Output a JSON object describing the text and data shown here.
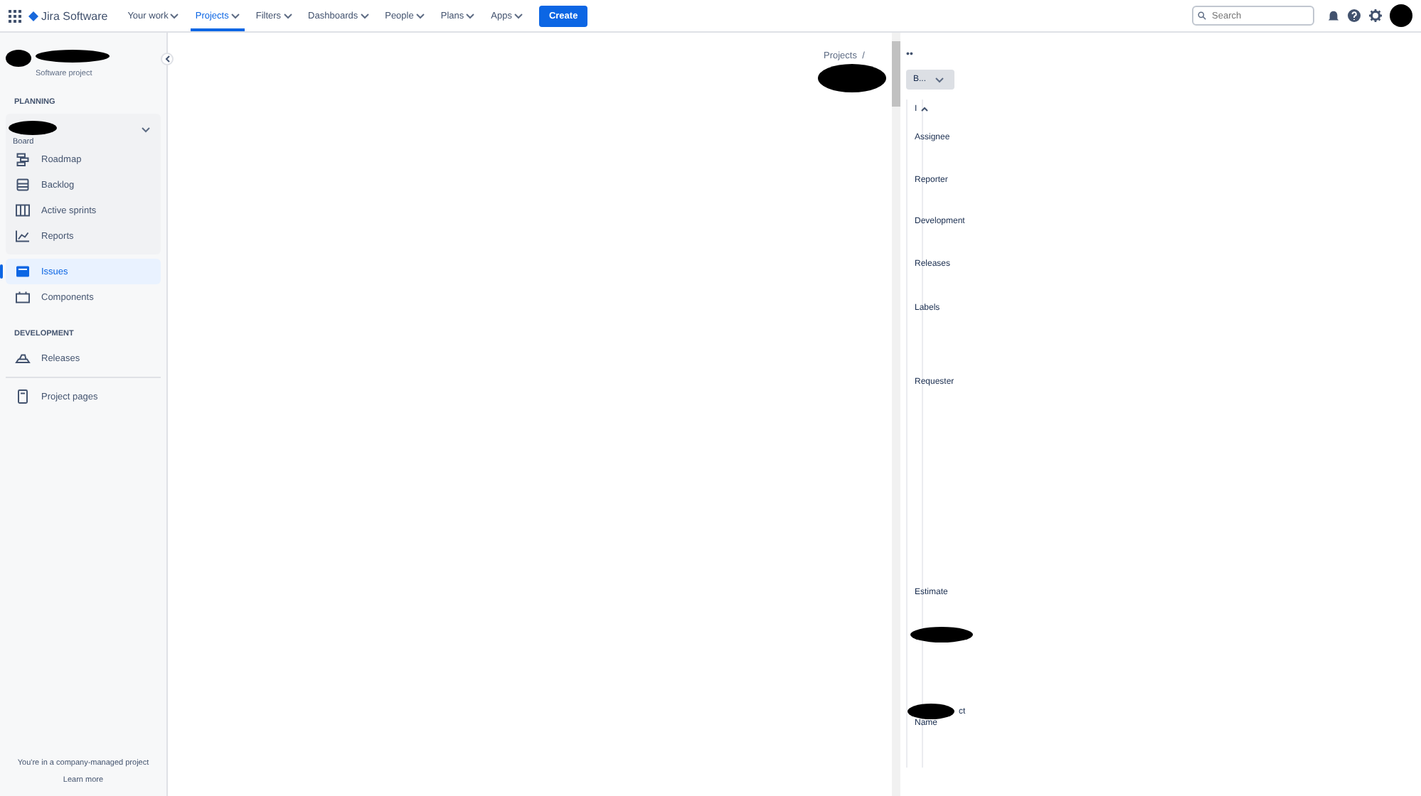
{
  "topbar": {
    "product": "Jira Software",
    "nav": [
      {
        "label": "Your work",
        "selected": false
      },
      {
        "label": "Projects",
        "selected": true
      },
      {
        "label": "Filters",
        "selected": false
      },
      {
        "label": "Dashboards",
        "selected": false
      },
      {
        "label": "People",
        "selected": false
      },
      {
        "label": "Plans",
        "selected": false
      },
      {
        "label": "Apps",
        "selected": false
      }
    ],
    "create": "Create",
    "search": {
      "placeholder": "Search"
    }
  },
  "sidebar": {
    "project_type": "Software project",
    "sections": [
      {
        "title": "PLANNING",
        "board": {
          "label": "Board",
          "expanded": true,
          "items": [
            {
              "label": "Roadmap",
              "kind": "roadmap",
              "selected": false
            },
            {
              "label": "Backlog",
              "kind": "backlog",
              "selected": false
            },
            {
              "label": "Active sprints",
              "kind": "sprints",
              "selected": false
            },
            {
              "label": "Reports",
              "kind": "reports",
              "selected": false
            }
          ]
        },
        "items": [
          {
            "label": "Issues",
            "kind": "issues",
            "selected": true
          },
          {
            "label": "Components",
            "kind": "components",
            "selected": false
          }
        ]
      },
      {
        "title": "DEVELOPMENT",
        "items": [
          {
            "label": "Releases",
            "kind": "releases",
            "selected": false
          }
        ]
      }
    ],
    "pages": {
      "label": "Project pages",
      "kind": "pages",
      "selected": false
    },
    "footer": {
      "text": "You're in a company-managed project",
      "link": "Learn more"
    }
  },
  "breadcrumb": "Projects  /",
  "details": {
    "more": "••",
    "status_button": "B...",
    "header": "I",
    "fields": [
      "Assignee",
      "Reporter",
      "Development",
      "Releases",
      "Labels",
      "Requester",
      "Estimate"
    ],
    "redacted_field_tail": "ct",
    "last_field": "Name"
  }
}
